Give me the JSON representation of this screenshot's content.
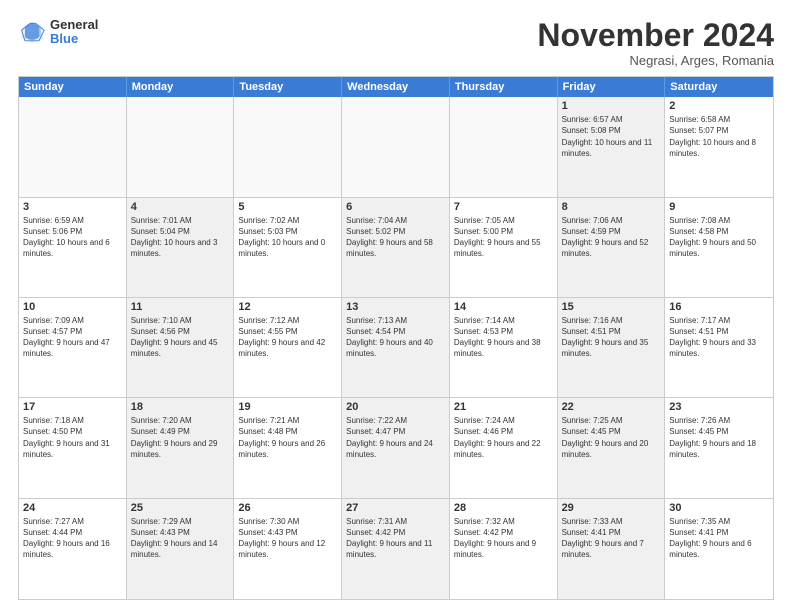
{
  "logo": {
    "general": "General",
    "blue": "Blue"
  },
  "title": "November 2024",
  "subtitle": "Negrasi, Arges, Romania",
  "header": {
    "days": [
      "Sunday",
      "Monday",
      "Tuesday",
      "Wednesday",
      "Thursday",
      "Friday",
      "Saturday"
    ]
  },
  "weeks": [
    [
      {
        "day": "",
        "info": "",
        "shaded": false,
        "empty": true
      },
      {
        "day": "",
        "info": "",
        "shaded": false,
        "empty": true
      },
      {
        "day": "",
        "info": "",
        "shaded": false,
        "empty": true
      },
      {
        "day": "",
        "info": "",
        "shaded": false,
        "empty": true
      },
      {
        "day": "",
        "info": "",
        "shaded": false,
        "empty": true
      },
      {
        "day": "1",
        "info": "Sunrise: 6:57 AM\nSunset: 5:08 PM\nDaylight: 10 hours and 11 minutes.",
        "shaded": true,
        "empty": false
      },
      {
        "day": "2",
        "info": "Sunrise: 6:58 AM\nSunset: 5:07 PM\nDaylight: 10 hours and 8 minutes.",
        "shaded": false,
        "empty": false
      }
    ],
    [
      {
        "day": "3",
        "info": "Sunrise: 6:59 AM\nSunset: 5:06 PM\nDaylight: 10 hours and 6 minutes.",
        "shaded": false,
        "empty": false
      },
      {
        "day": "4",
        "info": "Sunrise: 7:01 AM\nSunset: 5:04 PM\nDaylight: 10 hours and 3 minutes.",
        "shaded": true,
        "empty": false
      },
      {
        "day": "5",
        "info": "Sunrise: 7:02 AM\nSunset: 5:03 PM\nDaylight: 10 hours and 0 minutes.",
        "shaded": false,
        "empty": false
      },
      {
        "day": "6",
        "info": "Sunrise: 7:04 AM\nSunset: 5:02 PM\nDaylight: 9 hours and 58 minutes.",
        "shaded": true,
        "empty": false
      },
      {
        "day": "7",
        "info": "Sunrise: 7:05 AM\nSunset: 5:00 PM\nDaylight: 9 hours and 55 minutes.",
        "shaded": false,
        "empty": false
      },
      {
        "day": "8",
        "info": "Sunrise: 7:06 AM\nSunset: 4:59 PM\nDaylight: 9 hours and 52 minutes.",
        "shaded": true,
        "empty": false
      },
      {
        "day": "9",
        "info": "Sunrise: 7:08 AM\nSunset: 4:58 PM\nDaylight: 9 hours and 50 minutes.",
        "shaded": false,
        "empty": false
      }
    ],
    [
      {
        "day": "10",
        "info": "Sunrise: 7:09 AM\nSunset: 4:57 PM\nDaylight: 9 hours and 47 minutes.",
        "shaded": false,
        "empty": false
      },
      {
        "day": "11",
        "info": "Sunrise: 7:10 AM\nSunset: 4:56 PM\nDaylight: 9 hours and 45 minutes.",
        "shaded": true,
        "empty": false
      },
      {
        "day": "12",
        "info": "Sunrise: 7:12 AM\nSunset: 4:55 PM\nDaylight: 9 hours and 42 minutes.",
        "shaded": false,
        "empty": false
      },
      {
        "day": "13",
        "info": "Sunrise: 7:13 AM\nSunset: 4:54 PM\nDaylight: 9 hours and 40 minutes.",
        "shaded": true,
        "empty": false
      },
      {
        "day": "14",
        "info": "Sunrise: 7:14 AM\nSunset: 4:53 PM\nDaylight: 9 hours and 38 minutes.",
        "shaded": false,
        "empty": false
      },
      {
        "day": "15",
        "info": "Sunrise: 7:16 AM\nSunset: 4:51 PM\nDaylight: 9 hours and 35 minutes.",
        "shaded": true,
        "empty": false
      },
      {
        "day": "16",
        "info": "Sunrise: 7:17 AM\nSunset: 4:51 PM\nDaylight: 9 hours and 33 minutes.",
        "shaded": false,
        "empty": false
      }
    ],
    [
      {
        "day": "17",
        "info": "Sunrise: 7:18 AM\nSunset: 4:50 PM\nDaylight: 9 hours and 31 minutes.",
        "shaded": false,
        "empty": false
      },
      {
        "day": "18",
        "info": "Sunrise: 7:20 AM\nSunset: 4:49 PM\nDaylight: 9 hours and 29 minutes.",
        "shaded": true,
        "empty": false
      },
      {
        "day": "19",
        "info": "Sunrise: 7:21 AM\nSunset: 4:48 PM\nDaylight: 9 hours and 26 minutes.",
        "shaded": false,
        "empty": false
      },
      {
        "day": "20",
        "info": "Sunrise: 7:22 AM\nSunset: 4:47 PM\nDaylight: 9 hours and 24 minutes.",
        "shaded": true,
        "empty": false
      },
      {
        "day": "21",
        "info": "Sunrise: 7:24 AM\nSunset: 4:46 PM\nDaylight: 9 hours and 22 minutes.",
        "shaded": false,
        "empty": false
      },
      {
        "day": "22",
        "info": "Sunrise: 7:25 AM\nSunset: 4:45 PM\nDaylight: 9 hours and 20 minutes.",
        "shaded": true,
        "empty": false
      },
      {
        "day": "23",
        "info": "Sunrise: 7:26 AM\nSunset: 4:45 PM\nDaylight: 9 hours and 18 minutes.",
        "shaded": false,
        "empty": false
      }
    ],
    [
      {
        "day": "24",
        "info": "Sunrise: 7:27 AM\nSunset: 4:44 PM\nDaylight: 9 hours and 16 minutes.",
        "shaded": false,
        "empty": false
      },
      {
        "day": "25",
        "info": "Sunrise: 7:29 AM\nSunset: 4:43 PM\nDaylight: 9 hours and 14 minutes.",
        "shaded": true,
        "empty": false
      },
      {
        "day": "26",
        "info": "Sunrise: 7:30 AM\nSunset: 4:43 PM\nDaylight: 9 hours and 12 minutes.",
        "shaded": false,
        "empty": false
      },
      {
        "day": "27",
        "info": "Sunrise: 7:31 AM\nSunset: 4:42 PM\nDaylight: 9 hours and 11 minutes.",
        "shaded": true,
        "empty": false
      },
      {
        "day": "28",
        "info": "Sunrise: 7:32 AM\nSunset: 4:42 PM\nDaylight: 9 hours and 9 minutes.",
        "shaded": false,
        "empty": false
      },
      {
        "day": "29",
        "info": "Sunrise: 7:33 AM\nSunset: 4:41 PM\nDaylight: 9 hours and 7 minutes.",
        "shaded": true,
        "empty": false
      },
      {
        "day": "30",
        "info": "Sunrise: 7:35 AM\nSunset: 4:41 PM\nDaylight: 9 hours and 6 minutes.",
        "shaded": false,
        "empty": false
      }
    ]
  ]
}
